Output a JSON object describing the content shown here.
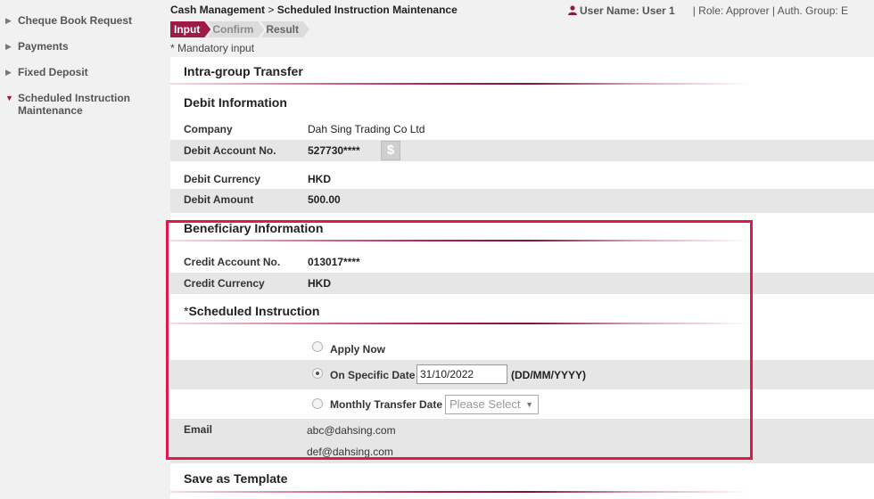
{
  "sidebar": {
    "items": [
      {
        "label": "Cheque Book Request",
        "expanded": false
      },
      {
        "label": "Payments",
        "expanded": false
      },
      {
        "label": "Fixed Deposit",
        "expanded": false
      },
      {
        "label": "Scheduled Instruction Maintenance",
        "expanded": true
      }
    ]
  },
  "header": {
    "breadcrumb_root": "Cash Management",
    "breadcrumb_sep": ">",
    "breadcrumb_page": "Scheduled Instruction Maintenance",
    "user_label": "User Name: User 1",
    "role_label": "| Role: Approver | Auth. Group: E"
  },
  "steps": [
    {
      "label": "Input",
      "active": true
    },
    {
      "label": "Confirm",
      "active": false
    },
    {
      "label": "Result",
      "active": false
    }
  ],
  "mandatory_note": "* Mandatory input",
  "transfer_title": "Intra-group Transfer",
  "debit": {
    "title": "Debit Information",
    "company_label": "Company",
    "company_value": "Dah Sing Trading Co Ltd",
    "account_label": "Debit Account No.",
    "account_value": "527730****",
    "dollar_symbol": "$",
    "currency_label": "Debit Currency",
    "currency_value": "HKD",
    "amount_label": "Debit Amount",
    "amount_value": "500.00"
  },
  "beneficiary": {
    "title": "Beneficiary Information",
    "account_label": "Credit Account No.",
    "account_value": "013017****",
    "currency_label": "Credit Currency",
    "currency_value": "HKD"
  },
  "schedule": {
    "required_mark": "*",
    "title": "Scheduled Instruction",
    "apply_now_label": "Apply Now",
    "specific_date_label": "On Specific Date",
    "specific_date_value": "31/10/2022",
    "date_format": "(DD/MM/YYYY)",
    "monthly_label": "Monthly Transfer Date",
    "monthly_select_value": "Please Select",
    "selected_option": "On Specific Date"
  },
  "email": {
    "label": "Email",
    "addresses": [
      "abc@dahsing.com",
      "def@dahsing.com"
    ]
  },
  "template_title": "Save as Template",
  "colors": {
    "accent": "#9e1b46",
    "highlight_border": "#e0184c",
    "row_grey": "#e6e6e6",
    "page_bg": "#f1f1f1"
  }
}
